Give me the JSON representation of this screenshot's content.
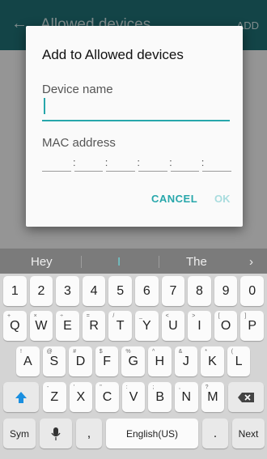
{
  "appbar": {
    "title": "Allowed devices",
    "add_label": "ADD",
    "back_icon": "arrow-back-icon"
  },
  "dialog": {
    "title": "Add to Allowed devices",
    "device_label": "Device name",
    "device_value": "",
    "mac_label": "MAC address",
    "mac_colon": ":",
    "cancel": "CANCEL",
    "ok": "OK"
  },
  "keyboard": {
    "suggestions": [
      "Hey",
      "I",
      "The"
    ],
    "suggestion_arrow": "›",
    "row1": [
      "1",
      "2",
      "3",
      "4",
      "5",
      "6",
      "7",
      "8",
      "9",
      "0"
    ],
    "row2": [
      "Q",
      "W",
      "E",
      "R",
      "T",
      "Y",
      "U",
      "I",
      "O",
      "P"
    ],
    "row2_alt": [
      "+",
      "×",
      "÷",
      "=",
      "/",
      "_",
      "<",
      ">",
      "[",
      "]"
    ],
    "row3": [
      "A",
      "S",
      "D",
      "F",
      "G",
      "H",
      "J",
      "K",
      "L"
    ],
    "row3_alt": [
      "!",
      "@",
      "#",
      "$",
      "%",
      "^",
      "&",
      "*",
      "("
    ],
    "row4": [
      "Z",
      "X",
      "C",
      "V",
      "B",
      "N",
      "M"
    ],
    "row4_alt": [
      "-",
      "'",
      "\"",
      ":",
      ";",
      ",",
      "?"
    ],
    "shift_icon": "shift-arrow-icon",
    "backspace_icon": "backspace-icon",
    "sym": "Sym",
    "mic_icon": "microphone-icon",
    "comma": ",",
    "space": "English(US)",
    "period": ".",
    "next": "Next",
    "accent": "#27a7ab"
  }
}
